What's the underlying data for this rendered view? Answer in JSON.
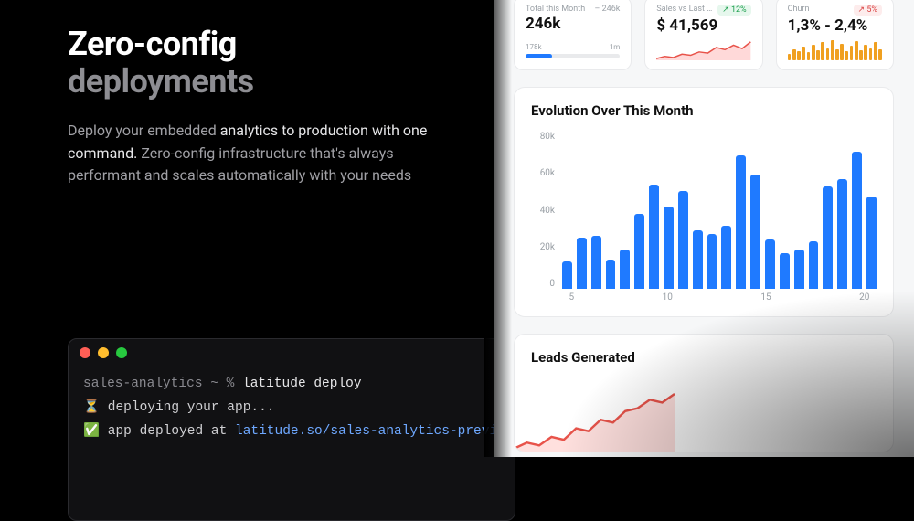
{
  "hero": {
    "title_main": "Zero-config",
    "title_sub": "deployments",
    "body_pre": "Deploy your embedded ",
    "body_em1": "analytics to production with one command. ",
    "body_mid": "Zero-config infrastructure that's always performant and scales automatically with your needs"
  },
  "terminal": {
    "prompt_path": "sales-analytics ~ % ",
    "prompt_cmd": "latitude deploy",
    "line1_icon": "⏳",
    "line1_text": " deploying your app...",
    "line2_icon": "✅",
    "line2_text": " app deployed at ",
    "line2_link": "latitude.so/sales-analytics-preview"
  },
  "dashboard": {
    "metrics": [
      {
        "label": "Total this Month",
        "value": "246k",
        "delta_text": "– 246k",
        "footer_left": "178k",
        "footer_right": "1m",
        "progress_pct": 28
      },
      {
        "label": "Sales vs Last Month",
        "value": "$ 41,569",
        "badge": "↗ 12%",
        "badge_kind": "up"
      },
      {
        "label": "Churn",
        "value": "1,3% - 2,4%",
        "badge": "↗ 5%",
        "badge_kind": "down"
      }
    ],
    "evolution": {
      "title": "Evolution Over This Month",
      "y_ticks": [
        "80k",
        "60k",
        "40k",
        "20k",
        "0"
      ],
      "x_ticks": [
        "5",
        "10",
        "15",
        "20"
      ]
    },
    "leads": {
      "title": "Leads Generated"
    }
  },
  "chart_data": [
    {
      "type": "bar",
      "title": "Evolution Over This Month",
      "xlabel": "",
      "ylabel": "",
      "ylim": [
        0,
        80000
      ],
      "x": [
        1,
        2,
        3,
        4,
        5,
        6,
        7,
        8,
        9,
        10,
        11,
        12,
        13,
        14,
        15,
        16,
        17,
        18,
        19,
        20,
        21,
        22
      ],
      "values": [
        14000,
        26000,
        27000,
        15000,
        20000,
        38000,
        53000,
        42000,
        50000,
        30000,
        28000,
        32000,
        68000,
        58000,
        25000,
        18000,
        20000,
        24000,
        52000,
        56000,
        70000,
        47000
      ]
    },
    {
      "type": "line",
      "title": "Sales vs Last Month sparkline",
      "x": [
        0,
        1,
        2,
        3,
        4,
        5,
        6,
        7,
        8,
        9,
        10,
        11
      ],
      "values": [
        10,
        12,
        11,
        14,
        13,
        16,
        15,
        20,
        18,
        22,
        19,
        25
      ]
    },
    {
      "type": "bar",
      "title": "Churn sparkbars",
      "x": [
        0,
        1,
        2,
        3,
        4,
        5,
        6,
        7,
        8,
        9,
        10,
        11,
        12,
        13,
        14,
        15,
        16,
        17,
        18,
        19
      ],
      "values": [
        6,
        10,
        8,
        12,
        7,
        14,
        9,
        16,
        11,
        18,
        10,
        15,
        8,
        13,
        17,
        9,
        14,
        11,
        16,
        10
      ]
    },
    {
      "type": "area",
      "title": "Leads Generated",
      "x": [
        0,
        1,
        2,
        3,
        4,
        5,
        6,
        7,
        8,
        9,
        10,
        11,
        12,
        13
      ],
      "values": [
        18,
        22,
        20,
        26,
        24,
        32,
        30,
        38,
        36,
        44,
        46,
        52,
        50,
        56
      ]
    }
  ]
}
